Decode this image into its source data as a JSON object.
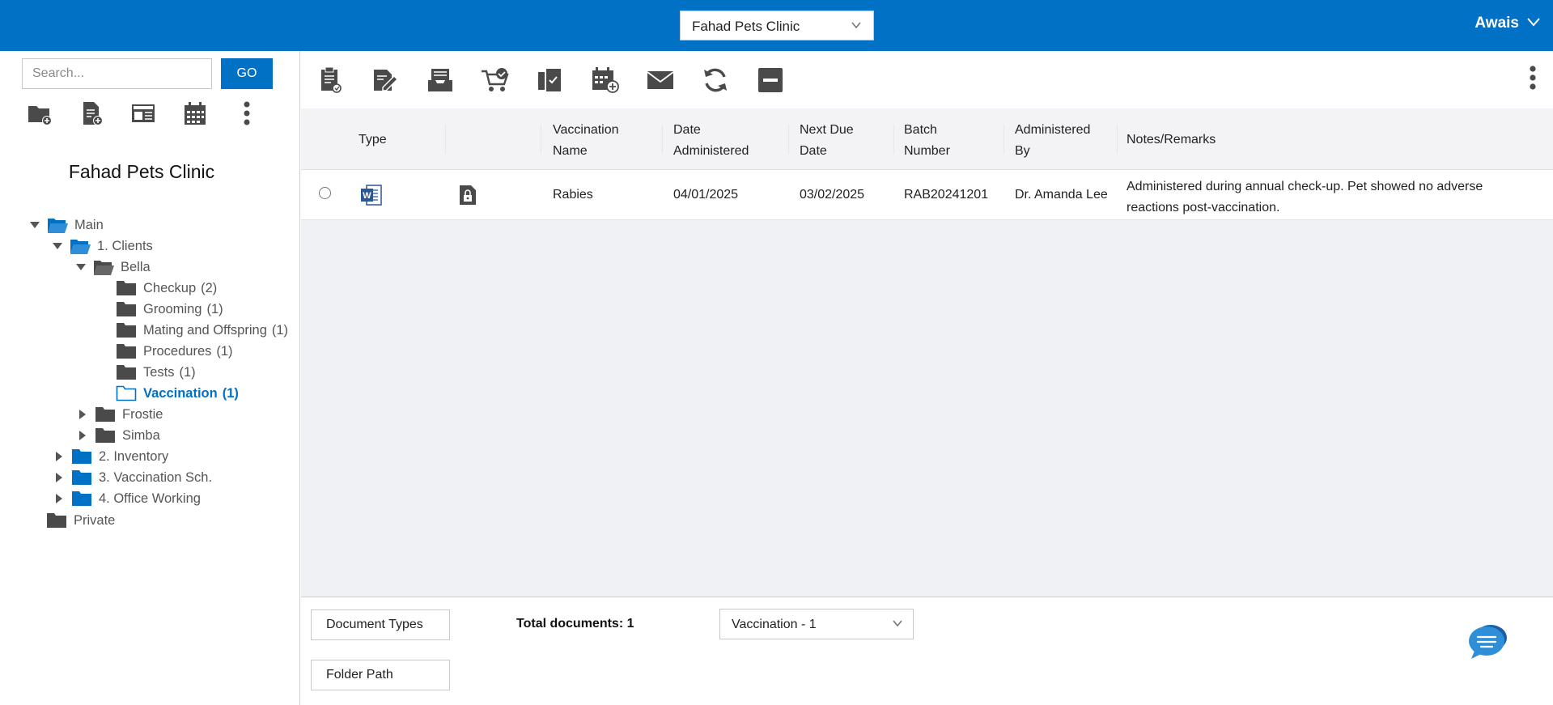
{
  "header": {
    "org_selected": "Fahad Pets Clinic",
    "user_name": "Awais"
  },
  "sidebar": {
    "search_placeholder": "Search...",
    "go_label": "GO",
    "tools": [
      "add-folder-icon",
      "add-document-icon",
      "form-icon",
      "calendar-icon",
      "more-vertical-icon"
    ],
    "title": "Fahad Pets Clinic",
    "tree": {
      "main": "Main",
      "clients": "1. Clients",
      "bella": "Bella",
      "checkup": {
        "label": "Checkup",
        "count": "(2)"
      },
      "grooming": {
        "label": "Grooming",
        "count": "(1)"
      },
      "mating": {
        "label": "Mating and Offspring",
        "count": "(1)"
      },
      "procedures": {
        "label": "Procedures",
        "count": "(1)"
      },
      "tests": {
        "label": "Tests",
        "count": "(1)"
      },
      "vaccination": {
        "label": "Vaccination",
        "count": "(1)"
      },
      "frostie": "Frostie",
      "simba": "Simba",
      "inventory": "2. Inventory",
      "vaccination_sch": "3. Vaccination Sch.",
      "office_working": "4. Office Working",
      "private": "Private"
    }
  },
  "toolbar": {
    "icons": [
      "clipboard-icon",
      "edit-document-icon",
      "inbox-tray-icon",
      "cart-check-icon",
      "documents-check-icon",
      "calendar-add-icon",
      "envelope-icon",
      "refresh-icon",
      "minus-box-icon",
      "more-vertical-icon"
    ]
  },
  "table": {
    "headers": {
      "type": "Type",
      "vaccination_name_1": "Vaccination",
      "vaccination_name_2": "Name",
      "date_admin_1": "Date",
      "date_admin_2": "Administered",
      "next_due_1": "Next Due",
      "next_due_2": "Date",
      "batch_1": "Batch",
      "batch_2": "Number",
      "admin_by_1": "Administered",
      "admin_by_2": "By",
      "notes": "Notes/Remarks"
    },
    "rows": [
      {
        "type_icon": "word-document-icon",
        "lock_icon": "locked-file-icon",
        "vaccination_name": "Rabies",
        "date_administered": "04/01/2025",
        "next_due_date": "03/02/2025",
        "batch_number": "RAB20241201",
        "administered_by": "Dr. Amanda Lee",
        "notes_line1": "Administered during annual check-up. Pet showed no adverse",
        "notes_line2": "reactions post-vaccination."
      }
    ]
  },
  "footer": {
    "document_types_label": "Document Types",
    "folder_path_label": "Folder Path",
    "total_documents": "Total documents: 1",
    "type_selected": "Vaccination - 1"
  },
  "colors": {
    "brand_blue": "#0071c5",
    "icon_gray": "#4a4a4a",
    "grid_bg": "#f0f1f4"
  }
}
